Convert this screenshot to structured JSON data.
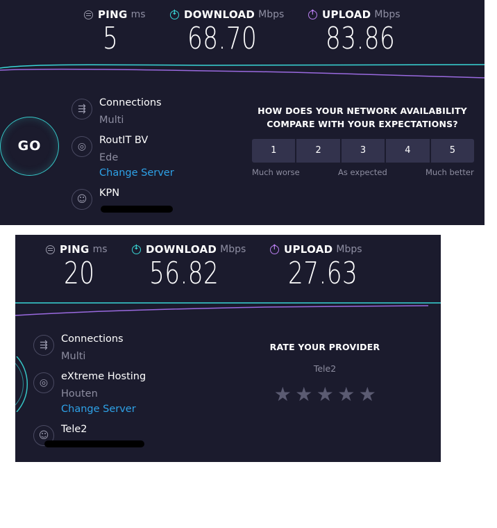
{
  "panel1": {
    "ping": {
      "label": "PING",
      "unit": "ms",
      "value": "5"
    },
    "download": {
      "label": "DOWNLOAD",
      "unit": "Mbps",
      "value": "68.70"
    },
    "upload": {
      "label": "UPLOAD",
      "unit": "Mbps",
      "value": "83.86"
    },
    "go_label": "GO",
    "connections": {
      "title": "Connections",
      "value": "Multi"
    },
    "server": {
      "name": "RoutIT BV",
      "location": "Ede",
      "change_label": "Change Server"
    },
    "provider": {
      "name": "KPN"
    },
    "survey": {
      "question": "HOW DOES YOUR NETWORK AVAILABILITY COMPARE WITH YOUR EXPECTATIONS?",
      "options": [
        "1",
        "2",
        "3",
        "4",
        "5"
      ],
      "low_label": "Much worse",
      "mid_label": "As expected",
      "high_label": "Much better"
    }
  },
  "panel2": {
    "ping": {
      "label": "PING",
      "unit": "ms",
      "value": "20"
    },
    "download": {
      "label": "DOWNLOAD",
      "unit": "Mbps",
      "value": "56.82"
    },
    "upload": {
      "label": "UPLOAD",
      "unit": "Mbps",
      "value": "27.63"
    },
    "connections": {
      "title": "Connections",
      "value": "Multi"
    },
    "server": {
      "name": "eXtreme Hosting",
      "location": "Houten",
      "change_label": "Change Server"
    },
    "provider": {
      "name": "Tele2"
    },
    "rating": {
      "title": "RATE YOUR PROVIDER",
      "provider": "Tele2",
      "stars": 5,
      "selected": 0
    }
  },
  "colors": {
    "background": "#1b1b2d",
    "download": "#39d6d6",
    "upload": "#b97ff0",
    "link": "#2ea2e8"
  },
  "icons": [
    "ping-icon",
    "download-icon",
    "upload-icon",
    "connections-icon",
    "globe-icon",
    "user-icon",
    "star-icon"
  ]
}
